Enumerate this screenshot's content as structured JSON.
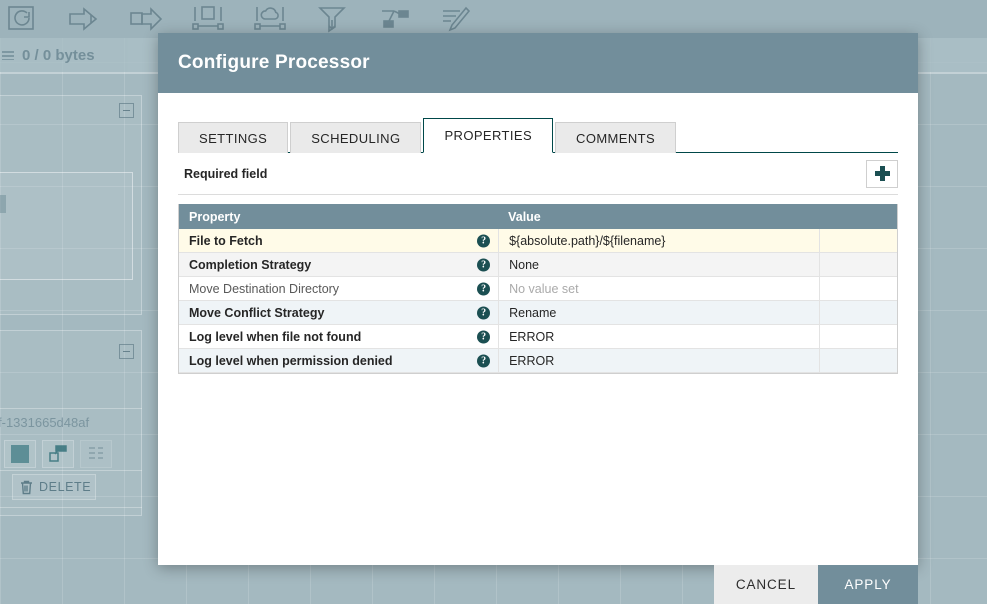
{
  "background": {
    "toolbar_icons": [
      "processor-icon",
      "input-port-icon",
      "output-port-icon",
      "process-group-icon",
      "remote-process-group-icon",
      "funnel-icon",
      "template-icon",
      "label-icon"
    ],
    "status_text": "0 / 0 bytes",
    "component_id": "f-1331665d48af",
    "delete_label": "DELETE",
    "mini_buttons": [
      "color-swatch-icon",
      "copy-icon",
      "template-icon"
    ]
  },
  "modal": {
    "title": "Configure Processor",
    "tabs": [
      {
        "label": "SETTINGS",
        "active": false
      },
      {
        "label": "SCHEDULING",
        "active": false
      },
      {
        "label": "PROPERTIES",
        "active": true
      },
      {
        "label": "COMMENTS",
        "active": false
      }
    ],
    "required_field_label": "Required field",
    "add_property_icon": "plus-icon",
    "table": {
      "columns": [
        "Property",
        "Value"
      ],
      "rows": [
        {
          "property": "File to Fetch",
          "value": "${absolute.path}/${filename}",
          "required": true,
          "unset": false,
          "selected": true
        },
        {
          "property": "Completion Strategy",
          "value": "None",
          "required": true,
          "unset": false,
          "selected": false
        },
        {
          "property": "Move Destination Directory",
          "value": "No value set",
          "required": false,
          "unset": true,
          "selected": false
        },
        {
          "property": "Move Conflict Strategy",
          "value": "Rename",
          "required": true,
          "unset": false,
          "selected": false
        },
        {
          "property": "Log level when file not found",
          "value": "ERROR",
          "required": true,
          "unset": false,
          "selected": false
        },
        {
          "property": "Log level when permission denied",
          "value": "ERROR",
          "required": true,
          "unset": false,
          "selected": false
        }
      ],
      "help_icon": "help-icon"
    },
    "footer": {
      "cancel_label": "CANCEL",
      "apply_label": "APPLY"
    }
  },
  "colors": {
    "header_bar": "#728e9b",
    "table_header": "#728e9b",
    "selected_row": "#fffbe8",
    "apply_button": "#728e9b",
    "cancel_button": "#ececec",
    "canvas": "#a4b9c0",
    "accent_dark": "#004849"
  }
}
